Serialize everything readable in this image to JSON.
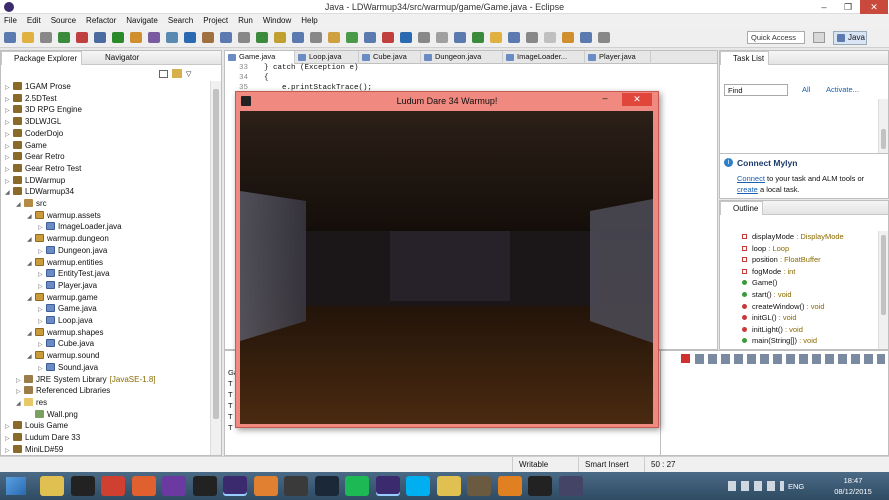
{
  "window": {
    "title": "Java - LDWarmup34/src/warmup/game/Game.java - Eclipse"
  },
  "menu": [
    "File",
    "Edit",
    "Source",
    "Refactor",
    "Navigate",
    "Search",
    "Project",
    "Run",
    "Window",
    "Help"
  ],
  "quick_access": {
    "placeholder": "Quick Access"
  },
  "perspective": {
    "label": "Java"
  },
  "package_explorer": {
    "tabs": [
      "Package Explorer",
      "Navigator"
    ],
    "tree": [
      {
        "label": "1GAM Prose",
        "depth": 0,
        "kind": "proj",
        "expand": "closed"
      },
      {
        "label": "2.5DTest",
        "depth": 0,
        "kind": "proj",
        "expand": "closed"
      },
      {
        "label": "3D RPG Engine",
        "depth": 0,
        "kind": "proj",
        "expand": "closed"
      },
      {
        "label": "3DLWJGL",
        "depth": 0,
        "kind": "proj",
        "expand": "closed"
      },
      {
        "label": "CoderDojo",
        "depth": 0,
        "kind": "proj",
        "expand": "closed"
      },
      {
        "label": "Game",
        "depth": 0,
        "kind": "proj",
        "expand": "closed"
      },
      {
        "label": "Gear Retro",
        "depth": 0,
        "kind": "proj",
        "expand": "closed"
      },
      {
        "label": "Gear Retro Test",
        "depth": 0,
        "kind": "proj",
        "expand": "closed"
      },
      {
        "label": "LDWarmup",
        "depth": 0,
        "kind": "proj",
        "expand": "closed"
      },
      {
        "label": "LDWarmup34",
        "depth": 0,
        "kind": "proj",
        "expand": "open"
      },
      {
        "label": "src",
        "depth": 1,
        "kind": "src",
        "expand": "open"
      },
      {
        "label": "warmup.assets",
        "depth": 2,
        "kind": "pkg",
        "expand": "open"
      },
      {
        "label": "ImageLoader.java",
        "depth": 3,
        "kind": "jf",
        "expand": "closed"
      },
      {
        "label": "warmup.dungeon",
        "depth": 2,
        "kind": "pkg",
        "expand": "open"
      },
      {
        "label": "Dungeon.java",
        "depth": 3,
        "kind": "jf",
        "expand": "closed"
      },
      {
        "label": "warmup.entities",
        "depth": 2,
        "kind": "pkg",
        "expand": "open"
      },
      {
        "label": "EntityTest.java",
        "depth": 3,
        "kind": "jf",
        "expand": "closed"
      },
      {
        "label": "Player.java",
        "depth": 3,
        "kind": "jf",
        "expand": "closed"
      },
      {
        "label": "warmup.game",
        "depth": 2,
        "kind": "pkg",
        "expand": "open"
      },
      {
        "label": "Game.java",
        "depth": 3,
        "kind": "jf",
        "expand": "closed"
      },
      {
        "label": "Loop.java",
        "depth": 3,
        "kind": "jf",
        "expand": "closed"
      },
      {
        "label": "warmup.shapes",
        "depth": 2,
        "kind": "pkg",
        "expand": "open"
      },
      {
        "label": "Cube.java",
        "depth": 3,
        "kind": "jf",
        "expand": "closed"
      },
      {
        "label": "warmup.sound",
        "depth": 2,
        "kind": "pkg",
        "expand": "open"
      },
      {
        "label": "Sound.java",
        "depth": 3,
        "kind": "jf",
        "expand": "closed"
      },
      {
        "label": "JRE System Library",
        "suffix": "[JavaSE-1.8]",
        "depth": 1,
        "kind": "lib",
        "expand": "closed"
      },
      {
        "label": "Referenced Libraries",
        "depth": 1,
        "kind": "lib",
        "expand": "closed"
      },
      {
        "label": "res",
        "depth": 1,
        "kind": "fold",
        "expand": "open"
      },
      {
        "label": "Wall.png",
        "depth": 2,
        "kind": "img",
        "expand": "none"
      },
      {
        "label": "Louis Game",
        "depth": 0,
        "kind": "proj",
        "expand": "closed"
      },
      {
        "label": "Ludum Dare 33",
        "depth": 0,
        "kind": "proj",
        "expand": "closed"
      },
      {
        "label": "MiniLD#59",
        "depth": 0,
        "kind": "proj",
        "expand": "closed"
      }
    ]
  },
  "editor": {
    "tabs": [
      "Game.java",
      "Loop.java",
      "Cube.java",
      "Dungeon.java",
      "ImageLoader...",
      "Player.java"
    ],
    "lines": [
      {
        "num": "33",
        "text": "} catch (Exception e)"
      },
      {
        "num": "34",
        "text": "{"
      },
      {
        "num": "35",
        "text": "    e.printStackTrace();"
      }
    ]
  },
  "game_window": {
    "title": "Ludum Dare 34 Warmup!"
  },
  "task_list": {
    "title": "Task List",
    "find_placeholder": "Find",
    "all_label": "All",
    "activate_label": "Activate..."
  },
  "mylyn": {
    "title": "Connect Mylyn",
    "link1": "Connect",
    "text1": " to your task and ALM tools or",
    "link2": "create",
    "text2": " a local task."
  },
  "outline": {
    "title": "Outline",
    "items": [
      {
        "name": "displayMode",
        "type": " : DisplayMode",
        "vis": "private",
        "icon": "field"
      },
      {
        "name": "loop",
        "type": " : Loop",
        "vis": "private",
        "icon": "field"
      },
      {
        "name": "position",
        "type": " : FloatBuffer",
        "vis": "private",
        "icon": "field",
        "mod": "F"
      },
      {
        "name": "fogMode",
        "type": " : int",
        "vis": "private",
        "icon": "field"
      },
      {
        "name": "Game()",
        "type": "",
        "vis": "public",
        "icon": "ctor",
        "mod": "c"
      },
      {
        "name": "start()",
        "type": " : void",
        "vis": "public",
        "icon": "method"
      },
      {
        "name": "createWindow()",
        "type": " : void",
        "vis": "private",
        "icon": "method"
      },
      {
        "name": "initGL()",
        "type": " : void",
        "vis": "private",
        "icon": "method"
      },
      {
        "name": "initLight()",
        "type": " : void",
        "vis": "private",
        "icon": "method"
      },
      {
        "name": "main(String[])",
        "type": " : void",
        "vis": "public",
        "icon": "method",
        "mod": "S"
      }
    ]
  },
  "console_lines": [
    "Ga",
    "T",
    "T",
    "T",
    "T",
    "T"
  ],
  "status": {
    "writable": "Writable",
    "insert": "Smart Insert",
    "pos": "50 : 27"
  },
  "tray": {
    "lang": "ENG",
    "time": "18:47",
    "date": "08/12/2015"
  },
  "colors": {
    "game_frame": "#f08a80",
    "link": "#1a5fb4",
    "type_text": "#8a6a00",
    "taskbar": "#2f4b63"
  }
}
